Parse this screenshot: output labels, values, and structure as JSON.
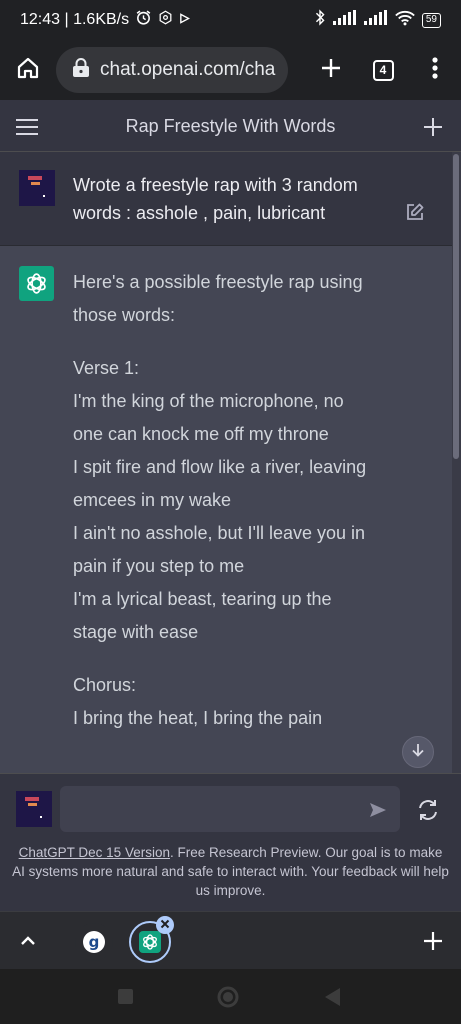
{
  "status_bar": {
    "time_speed": "12:43 | 1.6KB/s",
    "battery": "59"
  },
  "browser": {
    "url": "chat.openai.com/cha",
    "tab_count": "4"
  },
  "chat": {
    "title": "Rap Freestyle With Words"
  },
  "messages": {
    "user": {
      "text": "Wrote a freestyle rap with 3 random words : asshole , pain, lubricant"
    },
    "assistant": {
      "intro": "Here's a possible freestyle rap using those words:",
      "verse1_label": "Verse 1:",
      "verse1_lines": [
        "I'm the king of the microphone, no one can knock me off my throne",
        "I spit fire and flow like a river, leaving emcees in my wake",
        "I ain't no asshole, but I'll leave you in pain if you step to me",
        "I'm a lyrical beast, tearing up the stage with ease"
      ],
      "chorus_label": "Chorus:",
      "chorus_lines": [
        "I bring the heat, I bring the pain"
      ]
    }
  },
  "composer": {
    "input_value": "",
    "footer_link": "ChatGPT Dec 15 Version",
    "footer_text": ". Free Research Preview. Our goal is to make AI systems more natural and safe to interact with. Your feedback will help us improve."
  },
  "colors": {
    "background": "#343541",
    "assistant_bg": "#444654",
    "brand_green": "#10a37f",
    "browser_chrome": "#202124"
  },
  "icons": {
    "status": [
      "alarm-icon",
      "settings-icon",
      "play-icon",
      "bluetooth-icon",
      "signal-icon",
      "wifi-icon",
      "battery-icon"
    ],
    "browser": [
      "home-icon",
      "lock-icon",
      "plus-icon",
      "tab-count-icon",
      "more-vert-icon"
    ],
    "nav": [
      "recent-apps-icon",
      "home-circle-icon",
      "back-triangle-icon"
    ]
  }
}
